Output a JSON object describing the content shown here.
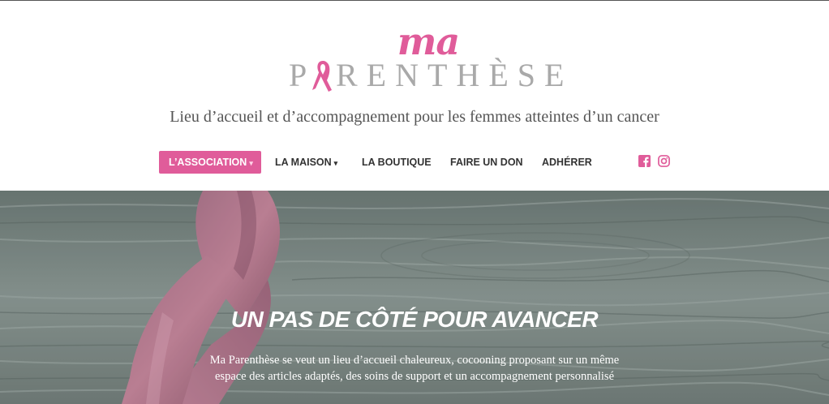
{
  "logo": {
    "script": "ma",
    "first_letter": "P",
    "rest": "RENTHÈSE",
    "brand_color": "#e05c9a"
  },
  "tagline": "Lieu d’accueil et d’accompagnement pour les femmes atteintes d’un cancer",
  "nav": {
    "items": [
      {
        "label": "L’ASSOCIATION",
        "dropdown": true,
        "active": true
      },
      {
        "label": "LA MAISON",
        "dropdown": true,
        "active": false
      },
      {
        "label": "LA BOUTIQUE",
        "dropdown": false,
        "active": false
      },
      {
        "label": "FAIRE UN DON",
        "dropdown": false,
        "active": false
      },
      {
        "label": "ADHÉRER",
        "dropdown": false,
        "active": false
      }
    ],
    "caret": "▾",
    "social": [
      "facebook-icon",
      "instagram-icon"
    ]
  },
  "hero": {
    "title": "UN PAS DE CÔTÉ POUR AVANCER",
    "text": "Ma Parenthèse se veut un lieu d’accueil chaleureux, cocooning proposant sur un même espace des articles adaptés, des soins de support et un accompagnement personnalisé"
  }
}
